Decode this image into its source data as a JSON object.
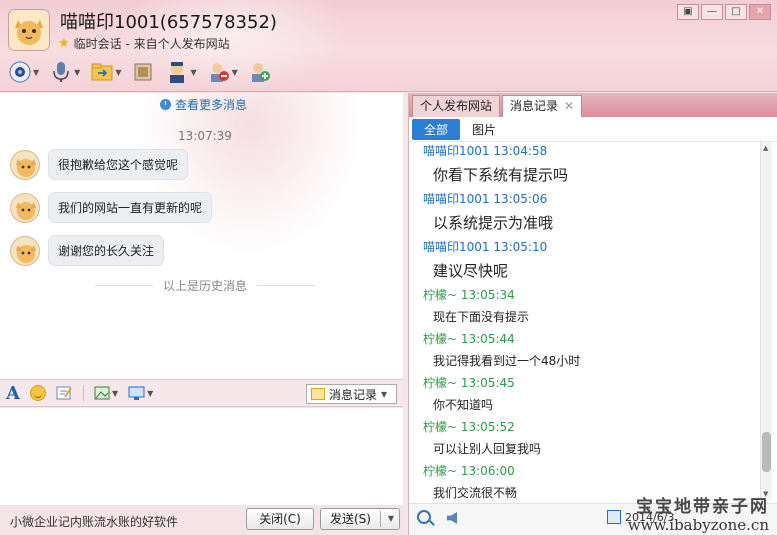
{
  "header": {
    "title": "喵喵印1001(657578352)",
    "subtitle": "临时会话 - 来自个人发布网站",
    "window_buttons": [
      "restore",
      "minimize",
      "maximize",
      "close"
    ]
  },
  "toolbar": {
    "items": [
      "video-camera-icon",
      "microphone-icon",
      "file-transfer-icon",
      "screen-share-icon",
      "remote-assist-icon",
      "block-user-icon",
      "add-friend-icon"
    ]
  },
  "chat": {
    "more_link": "查看更多消息",
    "time": "13:07:39",
    "messages": [
      "很抱歉给您这个感觉呢",
      "我们的网站一直有更新的呢",
      "谢谢您的长久关注"
    ],
    "history_label": "以上是历史消息"
  },
  "input_toolbar": {
    "history_button": "消息记录"
  },
  "bottom": {
    "ad": "小微企业记内账流水账的好软件",
    "close_button": "关闭(C)",
    "send_button": "发送(S)"
  },
  "right_panel": {
    "tabs": [
      "个人发布网站",
      "消息记录"
    ],
    "subtabs": [
      "全部",
      "图片"
    ],
    "log": [
      {
        "sender": "喵喵印1001 13:04:58",
        "text": "你看下系统有提示吗",
        "color": "blue",
        "size": "big"
      },
      {
        "sender": "喵喵印1001 13:05:06",
        "text": "以系统提示为准哦",
        "color": "blue",
        "size": "big"
      },
      {
        "sender": "喵喵印1001 13:05:10",
        "text": "建议尽快呢",
        "color": "blue",
        "size": "big"
      },
      {
        "sender": "柠檬~ 13:05:34",
        "text": "现在下面没有提示",
        "color": "green",
        "size": "small"
      },
      {
        "sender": "柠檬~ 13:05:44",
        "text": "我记得我看到过一个48小时",
        "color": "green",
        "size": "small"
      },
      {
        "sender": "柠檬~ 13:05:45",
        "text": "你不知道吗",
        "color": "green",
        "size": "small"
      },
      {
        "sender": "柠檬~ 13:05:52",
        "text": "可以让别人回复我吗",
        "color": "green",
        "size": "small"
      },
      {
        "sender": "柠檬~ 13:06:00",
        "text": "我们交流很不畅",
        "color": "green",
        "size": "small"
      }
    ],
    "date": "2014/6/3"
  },
  "watermark": {
    "cn": "宝宝地带亲子网",
    "url": "www.ibabyzone.cn"
  },
  "colors": {
    "accent": "#2a7fd4",
    "sender_blue": "#1f6fc6",
    "sender_green": "#2e9a47",
    "header_pink": "#f2cdd3"
  }
}
